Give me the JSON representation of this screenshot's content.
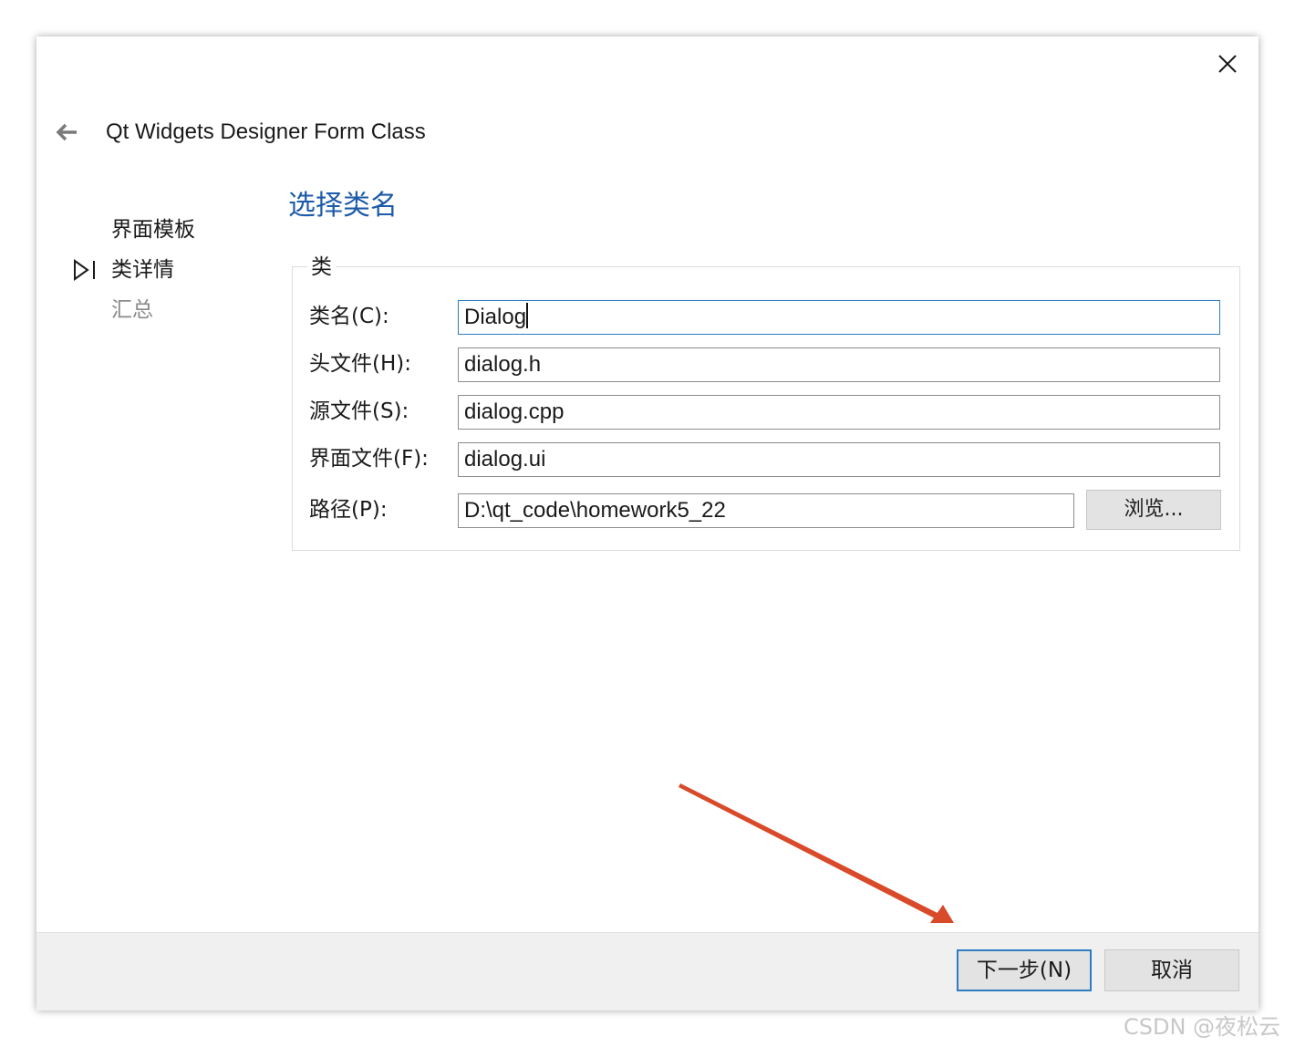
{
  "wizard": {
    "title": "Qt Widgets Designer Form Class",
    "page_title": "选择类名"
  },
  "steps": [
    {
      "label": "界面模板",
      "state": "done"
    },
    {
      "label": "类详情",
      "state": "current"
    },
    {
      "label": "汇总",
      "state": "pending"
    }
  ],
  "group": {
    "title": "类",
    "rows": [
      {
        "label": "类名(C):",
        "value": "Dialog"
      },
      {
        "label": "头文件(H):",
        "value": "dialog.h"
      },
      {
        "label": "源文件(S):",
        "value": "dialog.cpp"
      },
      {
        "label": "界面文件(F):",
        "value": "dialog.ui"
      },
      {
        "label": "路径(P):",
        "value": "D:\\qt_code\\homework5_22"
      }
    ],
    "browse_label": "浏览..."
  },
  "footer": {
    "next_label": "下一步(N)",
    "cancel_label": "取消"
  },
  "annotation": {
    "arrow_color": "#d84a2a"
  },
  "watermark": "CSDN @夜松云",
  "icons": {
    "close": "close-icon",
    "back": "back-arrow-icon",
    "current_step": "current-step-icon"
  },
  "colors": {
    "accent": "#2e7cc1",
    "page_title": "#1d5aa8",
    "footer_bg": "#f0f0f0"
  }
}
